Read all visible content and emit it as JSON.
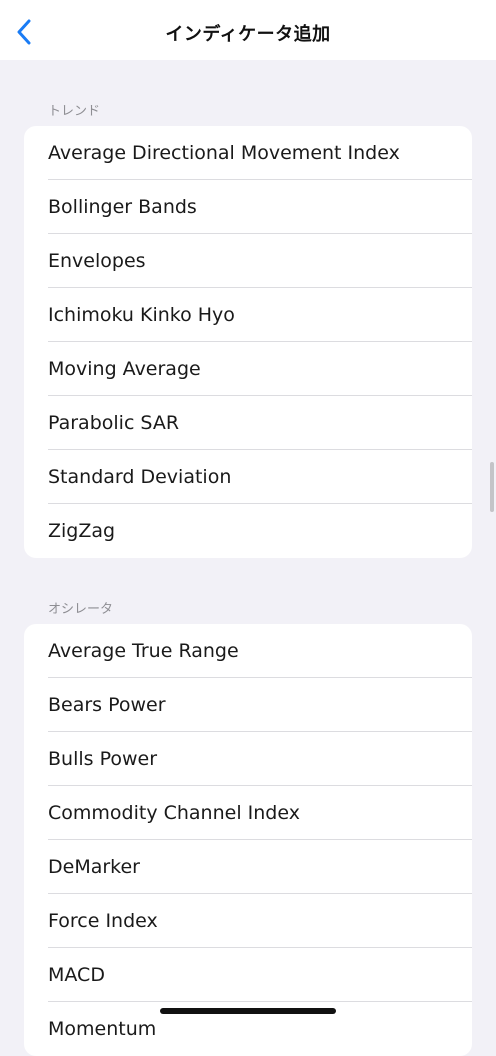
{
  "header": {
    "title": "インディケータ追加"
  },
  "sections": [
    {
      "title": "トレンド",
      "items": [
        "Average Directional Movement Index",
        "Bollinger Bands",
        "Envelopes",
        "Ichimoku Kinko Hyo",
        "Moving Average",
        "Parabolic SAR",
        "Standard Deviation",
        "ZigZag"
      ]
    },
    {
      "title": "オシレータ",
      "items": [
        "Average True Range",
        "Bears Power",
        "Bulls Power",
        "Commodity Channel Index",
        "DeMarker",
        "Force Index",
        "MACD",
        "Momentum"
      ]
    }
  ],
  "colors": {
    "accent": "#1a7cf5",
    "background": "#f2f1f7",
    "section_header": "#8e8e93"
  },
  "icons": {
    "back": "chevron-left-icon"
  }
}
